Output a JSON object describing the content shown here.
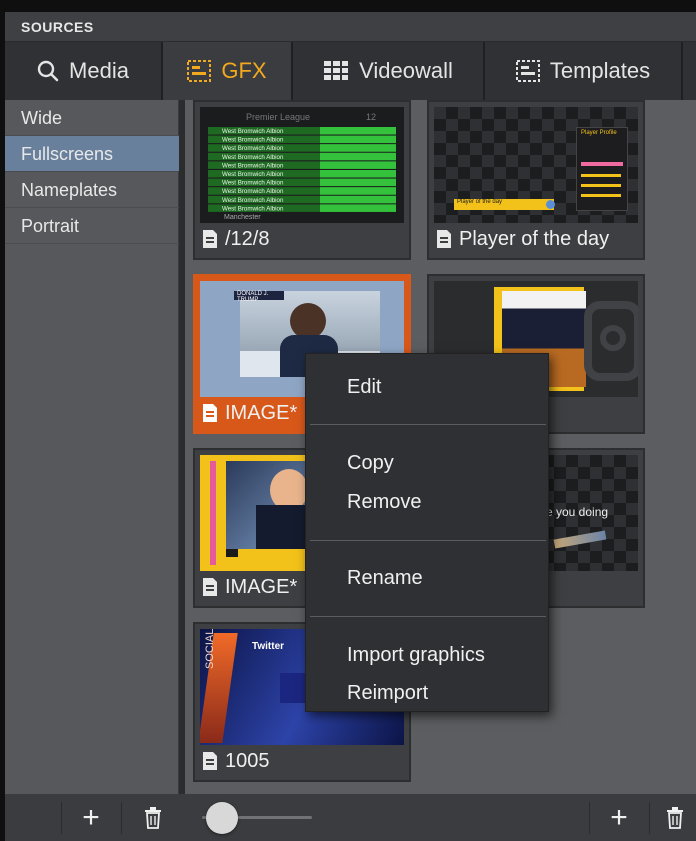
{
  "panel": {
    "title": "SOURCES"
  },
  "tabs": [
    {
      "label": "Media",
      "icon": "search-icon"
    },
    {
      "label": "GFX",
      "icon": "gfx-icon",
      "active": true
    },
    {
      "label": "Videowall",
      "icon": "videowall-icon"
    },
    {
      "label": "Templates",
      "icon": "templates-icon"
    }
  ],
  "categories": [
    {
      "label": "Wide"
    },
    {
      "label": "Fullscreens",
      "active": true
    },
    {
      "label": "Nameplates"
    },
    {
      "label": "Portrait"
    }
  ],
  "cards": [
    {
      "label": "/12/8",
      "thumb": {
        "title": "Premier League",
        "badge": "12",
        "row_text": "West Bromwich Albion",
        "last_row_text": "Manchester"
      }
    },
    {
      "label": "Player of the day",
      "thumb": {
        "caption": "Player of the day",
        "box_title": "Player Profile"
      }
    },
    {
      "label": "IMAGE*",
      "selected": true,
      "thumb": {
        "banner": "DONALD J. TRUMP"
      }
    },
    {
      "label": "",
      "thumb": {}
    },
    {
      "label": "IMAGE*",
      "thumb": {}
    },
    {
      "label": "",
      "thumb": {
        "overlay_text": "re you doing"
      }
    },
    {
      "label": "1005",
      "thumb": {
        "title": "Twitter",
        "side_text": "SOCIAL"
      }
    }
  ],
  "context_menu": {
    "items": [
      {
        "label": "Edit"
      },
      {
        "label": "Copy"
      },
      {
        "label": "Remove"
      },
      {
        "label": "Rename"
      },
      {
        "label": "Import graphics"
      },
      {
        "label": "Reimport"
      }
    ]
  },
  "bottom_bar": {
    "add_left": "+",
    "add_right": "+",
    "zoom_slider": 0.1
  },
  "colors": {
    "accent": "#f2a91d",
    "selected": "#d8581a",
    "list_active": "#68809c"
  }
}
